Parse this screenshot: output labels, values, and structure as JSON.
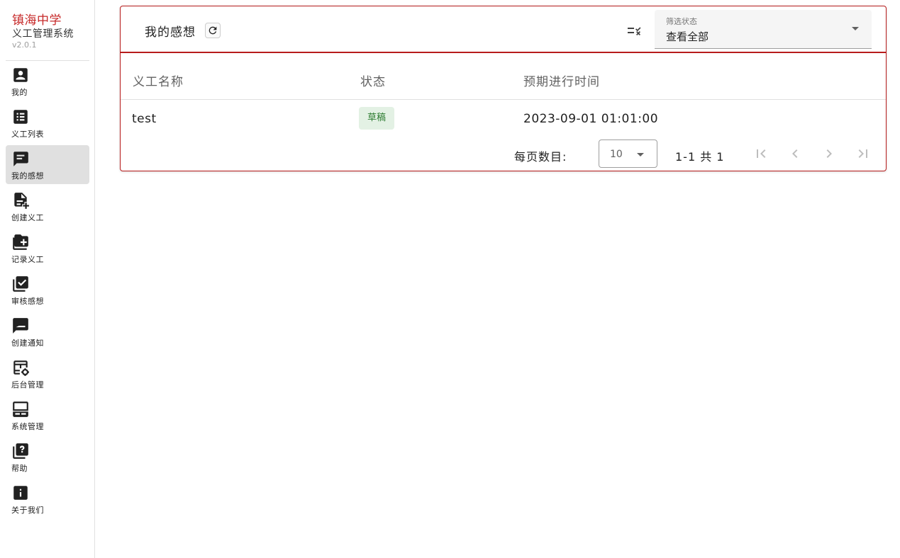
{
  "brand": {
    "school": "镇海中学",
    "system": "义工管理系统",
    "version": "v2.0.1"
  },
  "nav": [
    {
      "label": "我的",
      "icon": "account-box-icon"
    },
    {
      "label": "义工列表",
      "icon": "list-box-icon"
    },
    {
      "label": "我的感想",
      "icon": "message-text-icon",
      "active": true
    },
    {
      "label": "创建义工",
      "icon": "file-plus-icon"
    },
    {
      "label": "记录义工",
      "icon": "folder-plus-icon"
    },
    {
      "label": "审核感想",
      "icon": "checkbox-multiple-icon"
    },
    {
      "label": "创建通知",
      "icon": "message-draw-icon"
    },
    {
      "label": "后台管理",
      "icon": "table-cog-icon"
    },
    {
      "label": "系统管理",
      "icon": "server-laptop-icon"
    },
    {
      "label": "帮助",
      "icon": "help-box-icon"
    },
    {
      "label": "关于我们",
      "icon": "information-icon"
    }
  ],
  "toolbar": {
    "title": "我的感想",
    "filter": {
      "label": "筛选状态",
      "value": "查看全部"
    }
  },
  "table": {
    "headers": [
      "义工名称",
      "状态",
      "预期进行时间"
    ],
    "rows": [
      {
        "name": "test",
        "status": "草稿",
        "time": "2023-09-01 01:01:00"
      }
    ]
  },
  "pagination": {
    "per_page_label": "每页数目:",
    "per_page_value": "10",
    "range": "1-1 共 1"
  },
  "colors": {
    "accent": "#b71c1c",
    "brand_red": "#c62828",
    "chip_bg": "#e3f1e4",
    "chip_text": "#2e7d32"
  }
}
